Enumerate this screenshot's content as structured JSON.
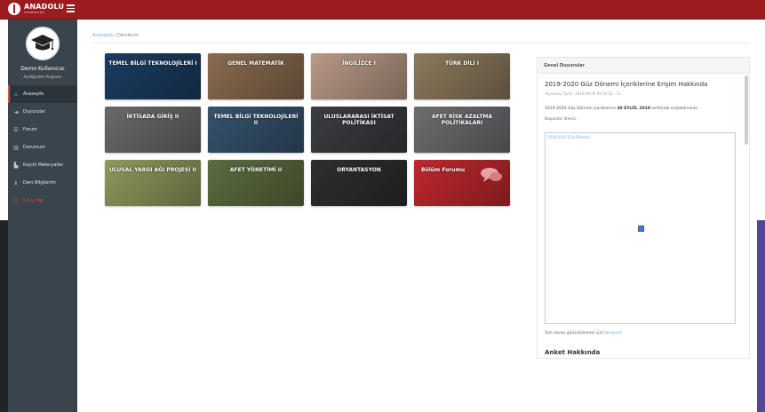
{
  "topbar": {
    "logo_text": "ANADOLU",
    "logo_sub": "ÜNİVERSİTESİ",
    "colors": {
      "brand": "#9b1b1f"
    }
  },
  "sidebar": {
    "user_name": "Demo Kullanıcısı",
    "user_program": "Açıköğretim Programı",
    "items": [
      {
        "label": "Anasayfa",
        "icon": "home-icon",
        "active": true
      },
      {
        "label": "Duyurular",
        "icon": "megaphone-icon",
        "active": false
      },
      {
        "label": "Forum",
        "icon": "forum-icon",
        "active": false
      },
      {
        "label": "Durumum",
        "icon": "chart-icon",
        "active": false
      },
      {
        "label": "Kayıtlı Materyaller",
        "icon": "bookmark-icon",
        "active": false
      },
      {
        "label": "Ders Bilgilerim",
        "icon": "info-icon",
        "active": false
      },
      {
        "label": "Çıkış Yap",
        "icon": "power-icon",
        "active": false
      }
    ]
  },
  "breadcrumb": {
    "home": "Anasayfa",
    "separator": "/",
    "current": "Derslerim"
  },
  "courses": [
    {
      "title": "TEMEL BİLGİ TEKNOLOJİLERİ I",
      "bg": "#1b3d63"
    },
    {
      "title": "GENEL MATEMATİK",
      "bg": "#8a6c4f"
    },
    {
      "title": "İNGİLİZCE I",
      "bg": "#b99a86"
    },
    {
      "title": "TÜRK DİLİ I",
      "bg": "#8d7a5c"
    },
    {
      "title": "İKTİSADA GİRİŞ II",
      "bg": "#6a6a6a"
    },
    {
      "title": "TEMEL BİLGİ TEKNOLOJİLERİ II",
      "bg": "#35536d"
    },
    {
      "title": "ULUSLARARASI İKTİSAT POLİTİKASI",
      "bg": "#3a3d41"
    },
    {
      "title": "AFET RİSK AZALTMA POLİTİKALARI",
      "bg": "#6d6e70"
    },
    {
      "title": "ULUSAL YARGI AĞI PROJESİ II",
      "bg": "#8d9a5b"
    },
    {
      "title": "AFET YÖNETİMİ II",
      "bg": "#5c6d3f"
    },
    {
      "title": "ORYANTASYON",
      "bg": "#2e2e2e"
    },
    {
      "title": "Bölüm Forumu",
      "bg": "#c0282d"
    }
  ],
  "announcements": {
    "header": "Genel Duyurular",
    "title": "2019-2020 Güz Dönemi İçeriklerine Erişim Hakkında",
    "meta": "Yayınlanış Tarihi: 2019-09-09 09:00:14 - 52",
    "body_prefix": "2019-2020 Güz Dönemi içeriklerine",
    "body_bold": "30 EYLÜL 2019",
    "body_suffix": "tarihinde erişebilirsiniz.",
    "regards": "Başarılar dileriz.",
    "embed_label": "2019-2020 Güz Dönemi",
    "fullscreen_prefix": "Tam ekran görüntülemek için",
    "fullscreen_link": "tıklayınız",
    "next_title": "Anket Hakkında"
  }
}
